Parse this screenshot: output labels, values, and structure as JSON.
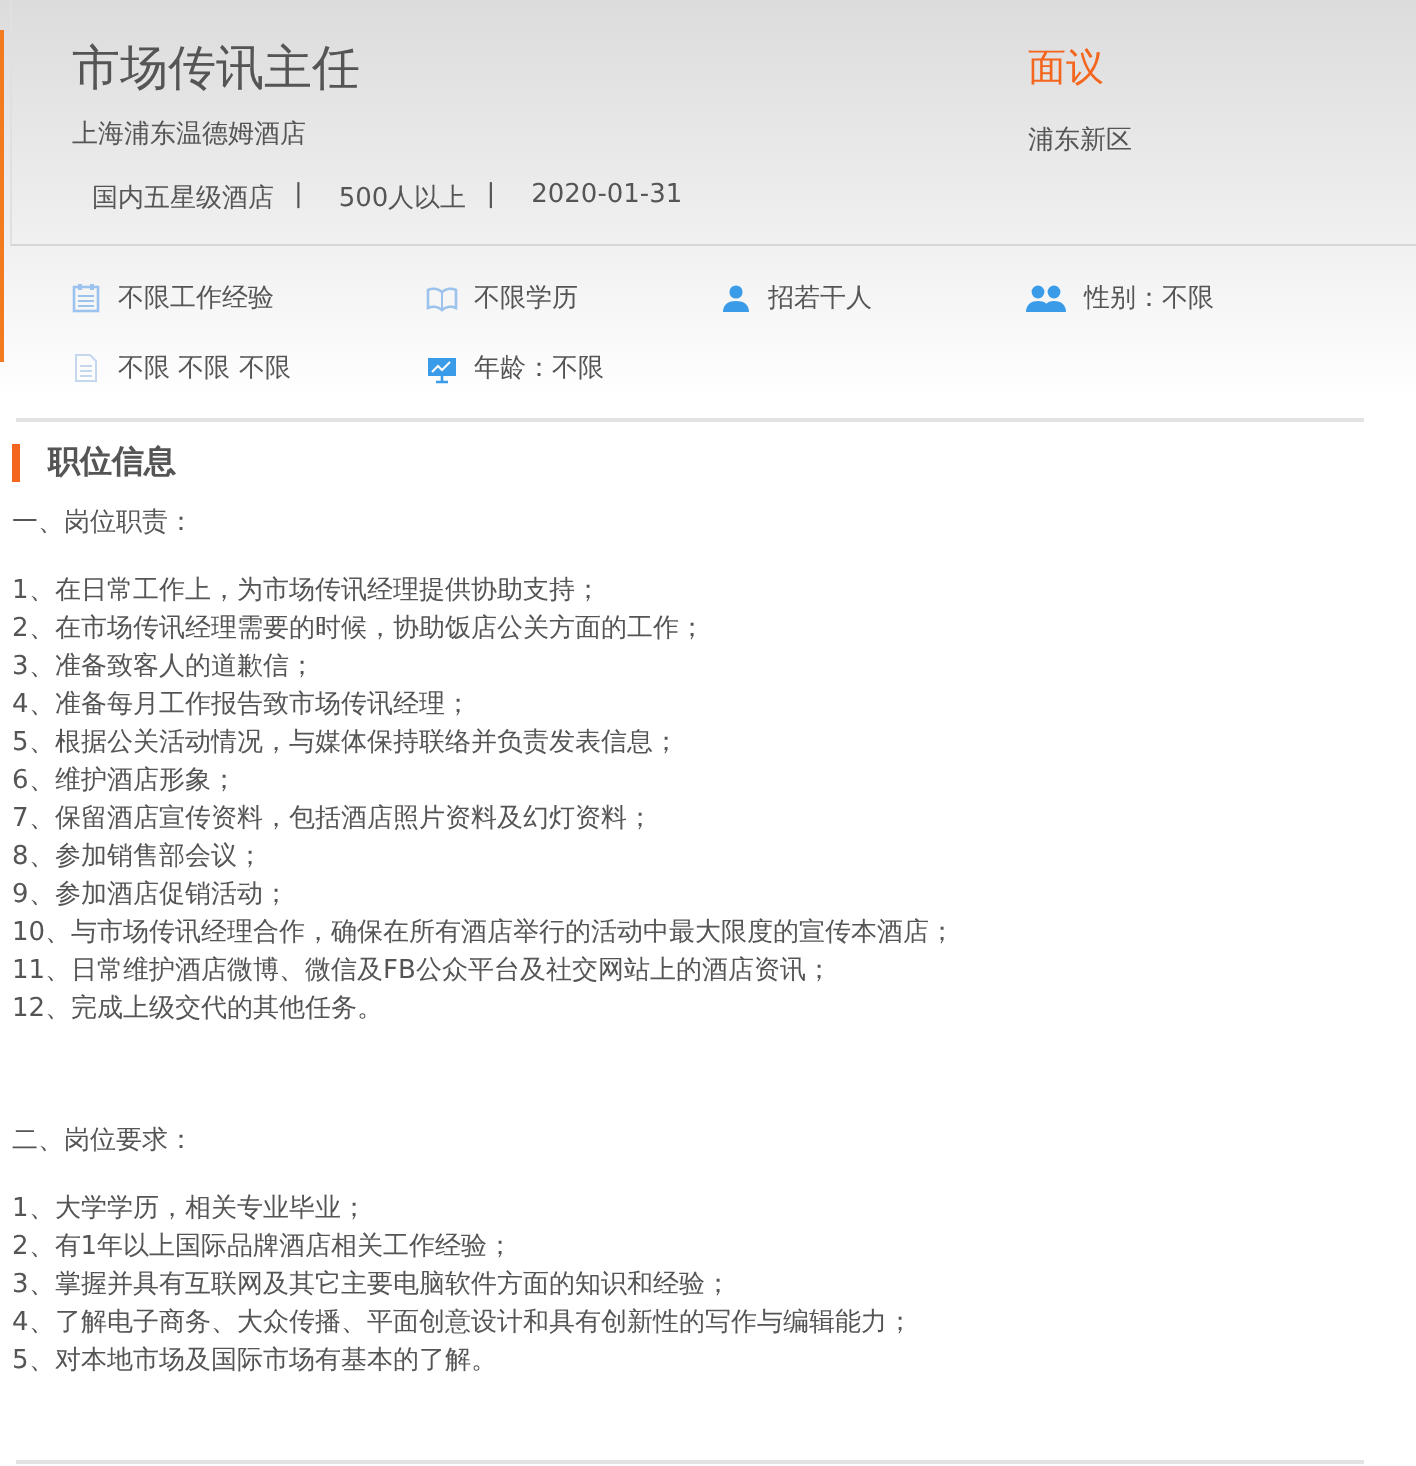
{
  "job": {
    "title": "市场传讯主任",
    "company": "上海浦东温德姆酒店",
    "salary": "面议",
    "location": "浦东新区",
    "meta": [
      "国内五星级酒店",
      "500人以上",
      "2020-01-31"
    ],
    "meta_separator": "|"
  },
  "attributes": [
    {
      "kind": "calendar",
      "text": "不限工作经验"
    },
    {
      "kind": "book",
      "text": "不限学历"
    },
    {
      "kind": "person",
      "text": "招若干人"
    },
    {
      "kind": "people",
      "text": "性别：不限"
    },
    {
      "kind": "document",
      "text": "不限 不限 不限"
    },
    {
      "kind": "board",
      "text": "年龄：不限"
    }
  ],
  "section": {
    "title": "职位信息",
    "blocks": [
      {
        "heading": "一、岗位职责：",
        "items": [
          "1、在日常工作上，为市场传讯经理提供协助支持；",
          "2、在市场传讯经理需要的时候，协助饭店公关方面的工作；",
          "3、准备致客人的道歉信；",
          "4、准备每月工作报告致市场传讯经理；",
          "5、根据公关活动情况，与媒体保持联络并负责发表信息；",
          "6、维护酒店形象；",
          "7、保留酒店宣传资料，包括酒店照片资料及幻灯资料；",
          "8、参加销售部会议；",
          "9、参加酒店促销活动；",
          "10、与市场传讯经理合作，确保在所有酒店举行的活动中最大限度的宣传本酒店；",
          "11、日常维护酒店微博、微信及FB公众平台及社交网站上的酒店资讯；",
          "12、完成上级交代的其他任务。"
        ]
      },
      {
        "heading": "二、岗位要求：",
        "items": [
          "1、大学学历，相关专业毕业；",
          "2、有1年以上国际品牌酒店相关工作经验；",
          "3、掌握并具有互联网及其它主要电脑软件方面的知识和经验；",
          "4、了解电子商务、大众传播、平面创意设计和具有创新性的写作与编辑能力；",
          "5、对本地市场及国际市场有基本的了解。"
        ]
      }
    ]
  }
}
